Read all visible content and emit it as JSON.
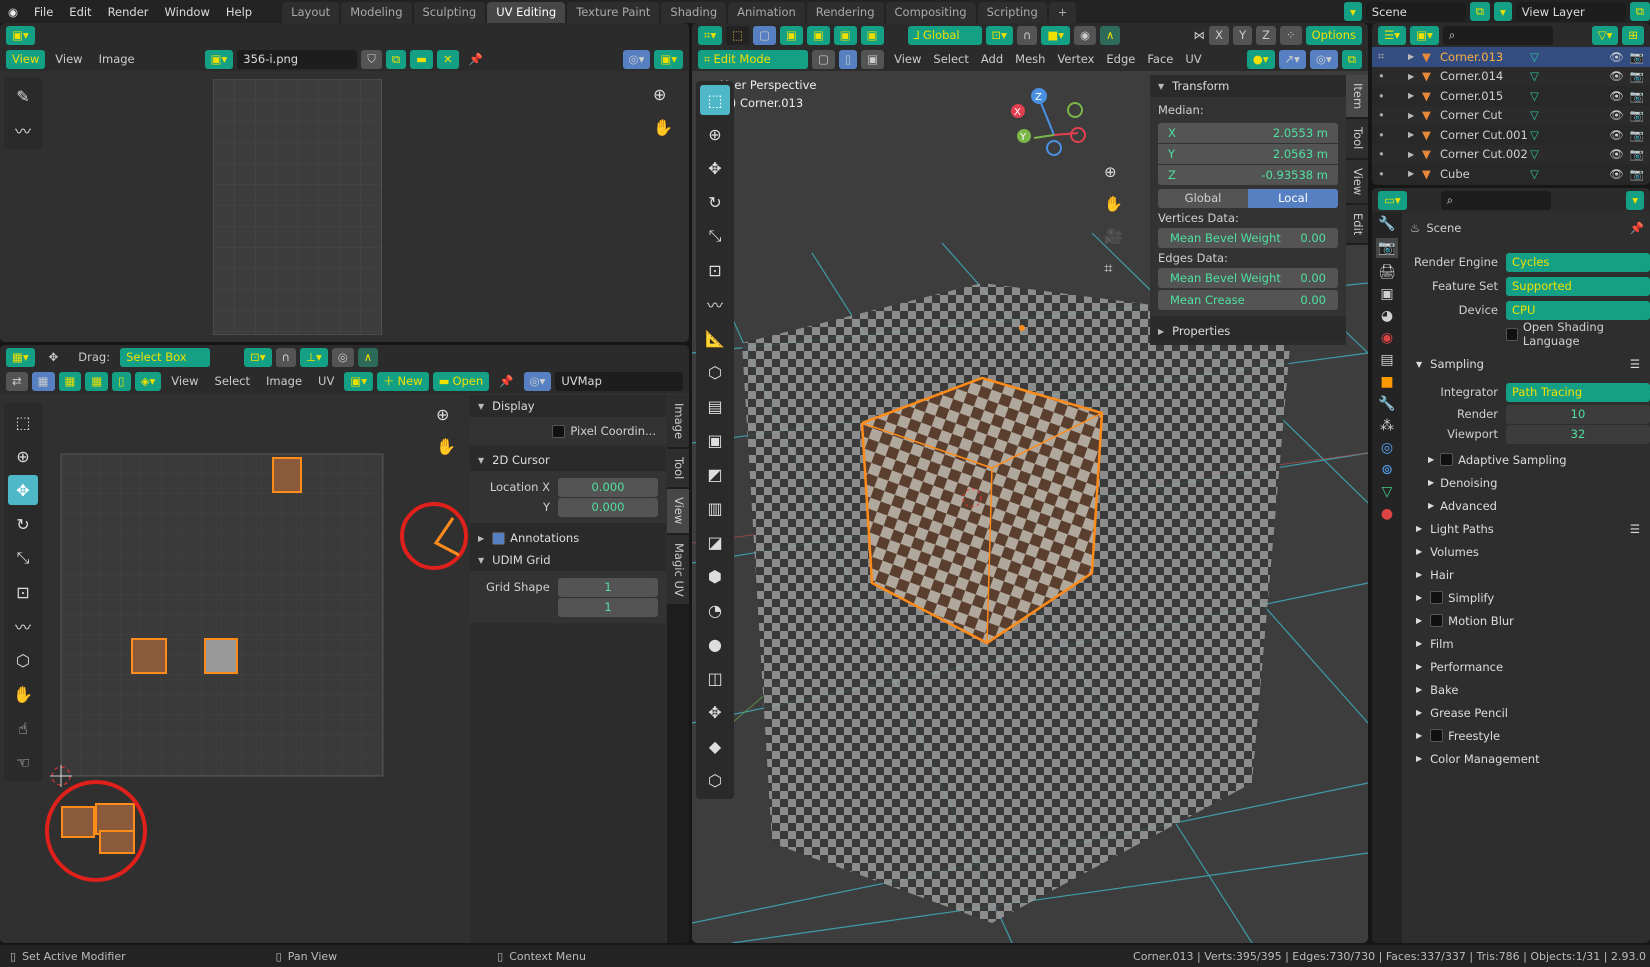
{
  "topbar": {
    "menus": [
      "File",
      "Edit",
      "Render",
      "Window",
      "Help"
    ],
    "tabs": [
      "Layout",
      "Modeling",
      "Sculpting",
      "UV Editing",
      "Texture Paint",
      "Shading",
      "Animation",
      "Rendering",
      "Compositing",
      "Scripting"
    ],
    "active_tab": "UV Editing",
    "add_tab": "+",
    "scene": "Scene",
    "view_layer": "View Layer"
  },
  "image_editor": {
    "view_mode": "View",
    "menus": [
      "View",
      "Image"
    ],
    "image_name": "356-i.png"
  },
  "uv_editor": {
    "drag_label": "Drag:",
    "drag_value": "Select Box",
    "menus": [
      "View",
      "Select",
      "Image",
      "UV"
    ],
    "new_label": "New",
    "open_label": "Open",
    "uvmap": "UVMap",
    "panel": {
      "display": "Display",
      "pixel_coords": "Pixel Coordin...",
      "cursor": "2D Cursor",
      "loc_x_label": "Location X",
      "loc_y_label": "Y",
      "loc_x": "0.000",
      "loc_y": "0.000",
      "annotations": "Annotations",
      "udim": "UDIM Grid",
      "grid_shape": "Grid Shape",
      "grid_x": "1",
      "grid_y": "1"
    },
    "side_tabs": [
      "Image",
      "Tool",
      "View",
      "Magic UV"
    ],
    "active_side_tab": "View"
  },
  "viewport": {
    "orientation": "Global",
    "options": "Options",
    "axes": [
      "X",
      "Y",
      "Z"
    ],
    "mode": "Edit Mode",
    "menus": [
      "View",
      "Select",
      "Add",
      "Mesh",
      "Vertex",
      "Edge",
      "Face",
      "UV"
    ],
    "perspective": "User Perspective",
    "object": "(1) Corner.013",
    "gizmo": {
      "x": "X",
      "y": "Y",
      "z": "Z"
    },
    "transform": {
      "title": "Transform",
      "median": "Median:",
      "x_label": "X",
      "x": "2.0553 m",
      "y_label": "Y",
      "y": "2.0563 m",
      "z_label": "Z",
      "z": "-0.93538 m",
      "global": "Global",
      "local": "Local",
      "vertices_data": "Vertices Data:",
      "v_bevel_label": "Mean Bevel Weight",
      "v_bevel": "0.00",
      "edges_data": "Edges Data:",
      "e_bevel_label": "Mean Bevel Weight",
      "e_bevel": "0.00",
      "crease_label": "Mean Crease",
      "crease": "0.00",
      "properties": "Properties"
    },
    "side_tabs": [
      "Item",
      "Tool",
      "View",
      "Edit"
    ],
    "active_side_tab": "Item"
  },
  "outliner": {
    "items": [
      {
        "name": "Corner.013",
        "selected": true
      },
      {
        "name": "Corner.014"
      },
      {
        "name": "Corner.015"
      },
      {
        "name": "Corner Cut"
      },
      {
        "name": "Corner Cut.001"
      },
      {
        "name": "Corner Cut.002"
      },
      {
        "name": "Cube"
      }
    ]
  },
  "properties": {
    "context": "Scene",
    "render_engine_label": "Render Engine",
    "render_engine": "Cycles",
    "feature_set_label": "Feature Set",
    "feature_set": "Supported",
    "device_label": "Device",
    "device": "CPU",
    "osl": "Open Shading Language",
    "sampling": "Sampling",
    "integrator_label": "Integrator",
    "integrator": "Path Tracing",
    "render_label": "Render",
    "render": "10",
    "viewport_label": "Viewport",
    "viewport": "32",
    "subsections": [
      {
        "label": "Adaptive Sampling",
        "checkbox": true
      },
      {
        "label": "Denoising"
      },
      {
        "label": "Advanced"
      }
    ],
    "sections": [
      {
        "label": "Light Paths"
      },
      {
        "label": "Volumes"
      },
      {
        "label": "Hair"
      },
      {
        "label": "Simplify",
        "checkbox": true
      },
      {
        "label": "Motion Blur",
        "checkbox": true
      },
      {
        "label": "Film"
      },
      {
        "label": "Performance"
      },
      {
        "label": "Bake"
      },
      {
        "label": "Grease Pencil"
      },
      {
        "label": "Freestyle",
        "checkbox": true
      },
      {
        "label": "Color Management"
      }
    ]
  },
  "status": {
    "left": "Set Active Modifier",
    "middle": "Pan View",
    "right": "Context Menu",
    "stats": "Corner.013 | Verts:395/395 | Edges:730/730 | Faces:337/337 | Tris:786 | Objects:1/31 | 2.93.0"
  },
  "colors": {
    "accent": "#14a085",
    "selection": "#ff8c1a",
    "active_blue": "#5680c2",
    "annotation_red": "#e0201a"
  }
}
